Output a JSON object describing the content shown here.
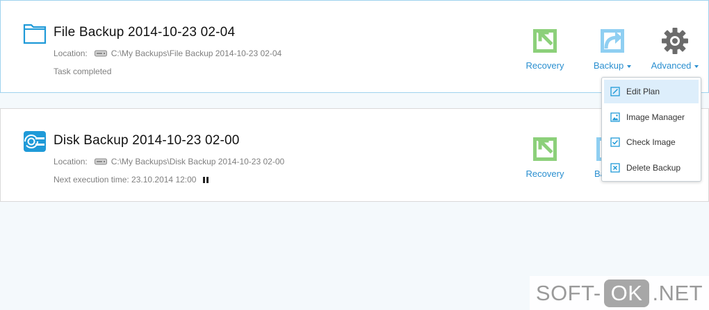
{
  "tasks": [
    {
      "icon": "folder-icon",
      "title": "File Backup 2014-10-23 02-04",
      "location_label": "Location:",
      "location_path": "C:\\My Backups\\File Backup 2014-10-23 02-04",
      "status": "Task completed"
    },
    {
      "icon": "disk-backup-icon",
      "title": "Disk Backup 2014-10-23 02-00",
      "location_label": "Location:",
      "location_path": "C:\\My Backups\\Disk Backup 2014-10-23 02-00",
      "status": "Next execution time: 23.10.2014 12:00"
    }
  ],
  "actions": {
    "recovery_label": "Recovery",
    "backup_label": "Backup",
    "backup_label_partial": "Ba",
    "advanced_label": "Advanced"
  },
  "advanced_menu": {
    "items": [
      {
        "label": "Edit Plan",
        "icon": "edit-icon"
      },
      {
        "label": "Image Manager",
        "icon": "image-icon"
      },
      {
        "label": "Check Image",
        "icon": "checkbox-icon"
      },
      {
        "label": "Delete Backup",
        "icon": "delete-icon"
      }
    ],
    "active_item": "Edit Plan"
  },
  "watermark": {
    "prefix": "SOFT-",
    "highlight": "OK",
    "suffix": ".NET"
  },
  "colors": {
    "accent": "#2a8fd0",
    "recovery_green": "#8cd07a",
    "backup_blue": "#8fcff2",
    "gear_gray": "#6b6b6b",
    "page_bg": "#f4f9fc"
  }
}
